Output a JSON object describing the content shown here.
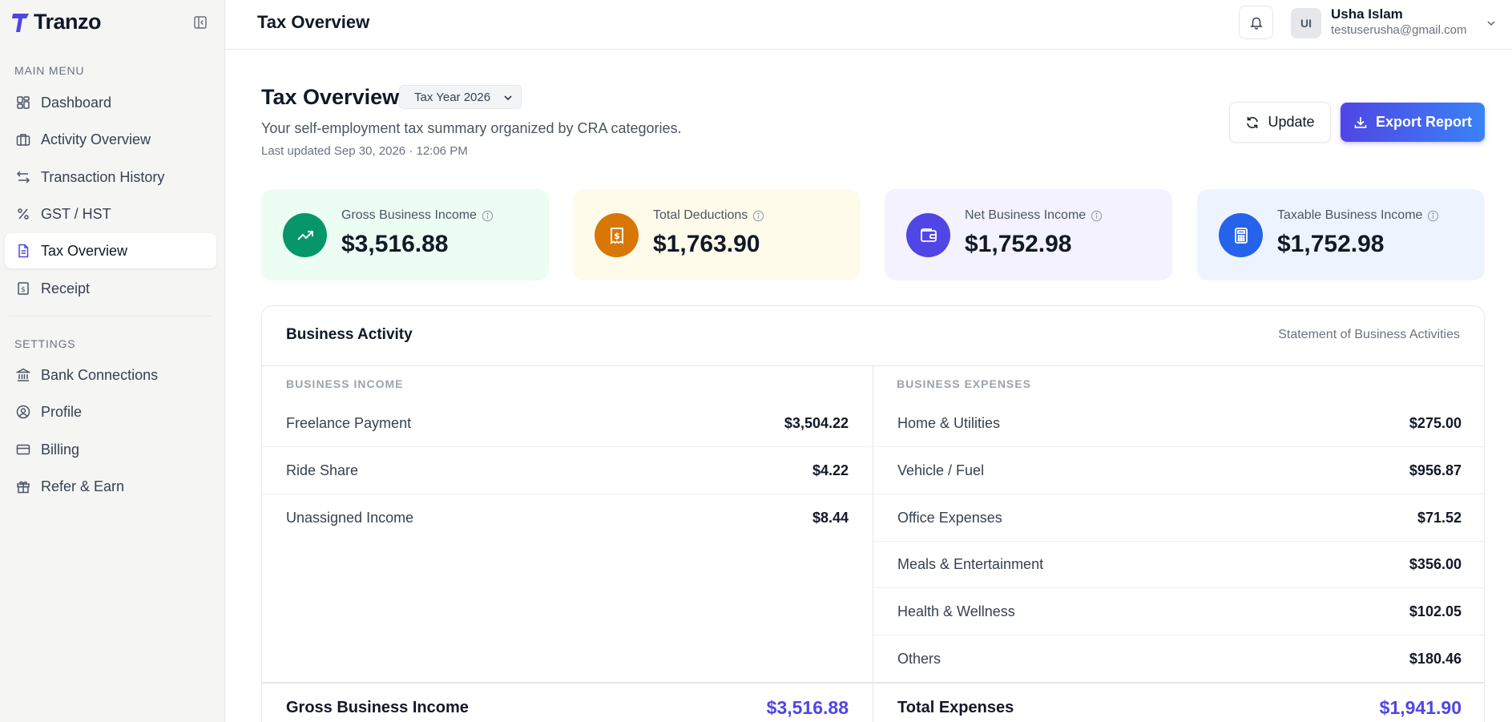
{
  "brand": {
    "name": "Tranzo"
  },
  "sidebar": {
    "main_menu_label": "MAIN MENU",
    "main_items": [
      {
        "label": "Dashboard",
        "icon": "dashboard-icon"
      },
      {
        "label": "Activity Overview",
        "icon": "briefcase-icon"
      },
      {
        "label": "Transaction History",
        "icon": "arrows-swap-icon"
      },
      {
        "label": "GST / HST",
        "icon": "percent-icon"
      },
      {
        "label": "Tax Overview",
        "icon": "document-icon",
        "active": true
      },
      {
        "label": "Receipt",
        "icon": "receipt-icon"
      }
    ],
    "settings_label": "SETTINGS",
    "settings_items": [
      {
        "label": "Bank Connections",
        "icon": "bank-icon"
      },
      {
        "label": "Profile",
        "icon": "user-circle-icon"
      },
      {
        "label": "Billing",
        "icon": "credit-card-icon"
      },
      {
        "label": "Refer & Earn",
        "icon": "gift-icon"
      }
    ]
  },
  "topbar": {
    "title": "Tax Overview",
    "user": {
      "initials": "UI",
      "name": "Usha Islam",
      "email": "testuserusha@gmail.com"
    }
  },
  "header": {
    "title": "Tax Overview",
    "year_select": "Tax Year 2026",
    "subtitle": "Your self-employment tax summary organized by CRA categories.",
    "last_updated": "Last updated Sep 30, 2026 · 12:06 PM",
    "update_label": "Update",
    "export_label": "Export Report"
  },
  "cards": [
    {
      "label": "Gross Business Income",
      "value": "$3,516.88",
      "bg": "#ecfdf3",
      "accent": "#059669",
      "icon": "trending-up-icon"
    },
    {
      "label": "Total Deductions",
      "value": "$1,763.90",
      "bg": "#fffbeb",
      "accent": "#d97706",
      "icon": "receipt-dollar-icon"
    },
    {
      "label": "Net Business Income",
      "value": "$1,752.98",
      "bg": "#f3f2fe",
      "accent": "#4f46e5",
      "icon": "wallet-icon"
    },
    {
      "label": "Taxable Business Income",
      "value": "$1,752.98",
      "bg": "#eef4ff",
      "accent": "#2563eb",
      "icon": "calculator-icon"
    }
  ],
  "activity": {
    "title": "Business Activity",
    "subtitle": "Statement of Business Activities",
    "income": {
      "heading": "BUSINESS INCOME",
      "rows": [
        {
          "label": "Freelance Payment",
          "amount": "$3,504.22"
        },
        {
          "label": "Ride Share",
          "amount": "$4.22"
        },
        {
          "label": "Unassigned Income",
          "amount": "$8.44"
        }
      ],
      "total_label": "Gross Business Income",
      "total_amount": "$3,516.88"
    },
    "expenses": {
      "heading": "BUSINESS EXPENSES",
      "rows": [
        {
          "label": "Home & Utilities",
          "amount": "$275.00"
        },
        {
          "label": "Vehicle / Fuel",
          "amount": "$956.87"
        },
        {
          "label": "Office Expenses",
          "amount": "$71.52"
        },
        {
          "label": "Meals & Entertainment",
          "amount": "$356.00"
        },
        {
          "label": "Health & Wellness",
          "amount": "$102.05"
        },
        {
          "label": "Others",
          "amount": "$180.46"
        }
      ],
      "total_label": "Total Expenses",
      "total_amount": "$1,941.90"
    }
  }
}
